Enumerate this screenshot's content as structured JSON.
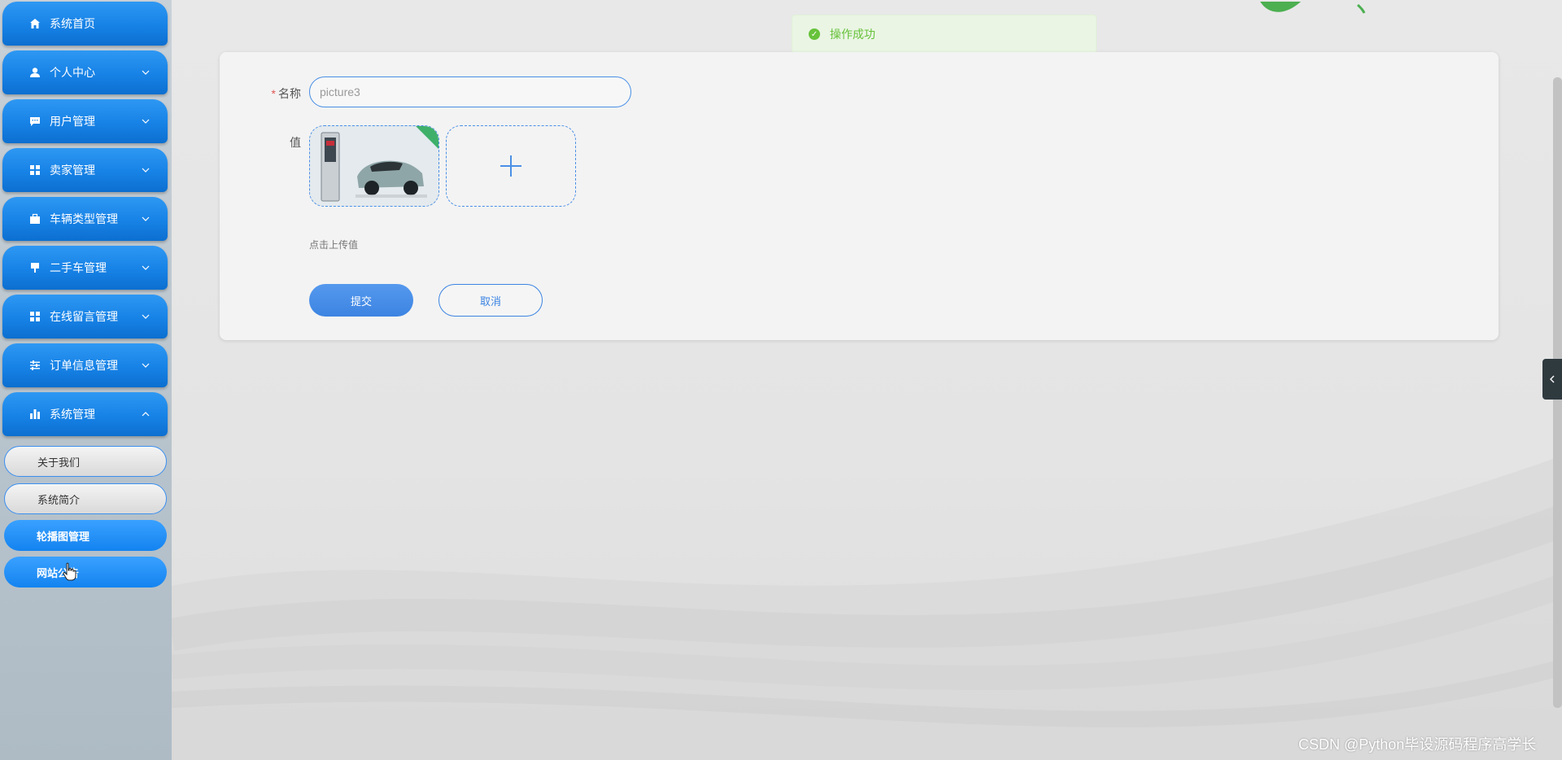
{
  "sidebar": {
    "menu": [
      {
        "label": "系统首页",
        "icon": "home-icon",
        "arrow": ""
      },
      {
        "label": "个人中心",
        "icon": "user-icon",
        "arrow": "down"
      },
      {
        "label": "用户管理",
        "icon": "chat-icon",
        "arrow": "down"
      },
      {
        "label": "卖家管理",
        "icon": "grid-icon",
        "arrow": "down"
      },
      {
        "label": "车辆类型管理",
        "icon": "briefcase-icon",
        "arrow": "down"
      },
      {
        "label": "二手车管理",
        "icon": "pin-icon",
        "arrow": "down"
      },
      {
        "label": "在线留言管理",
        "icon": "grid-icon",
        "arrow": "down"
      },
      {
        "label": "订单信息管理",
        "icon": "sliders-icon",
        "arrow": "down"
      },
      {
        "label": "系统管理",
        "icon": "bar-chart-icon",
        "arrow": "up"
      }
    ],
    "submenu": [
      {
        "label": "关于我们",
        "state": "plain"
      },
      {
        "label": "系统简介",
        "state": "plain"
      },
      {
        "label": "轮播图管理",
        "state": "active"
      },
      {
        "label": "网站公告",
        "state": "active"
      }
    ]
  },
  "toast": {
    "message": "操作成功",
    "color": "#67c23a"
  },
  "form": {
    "name_label": "名称",
    "name_value": "picture3",
    "value_label": "值",
    "upload_hint": "点击上传值",
    "submit_label": "提交",
    "cancel_label": "取消"
  },
  "watermark": "CSDN @Python毕设源码程序高学长",
  "colors": {
    "primary": "#1782e6",
    "accent": "#4a8fe6",
    "success": "#67c23a"
  }
}
